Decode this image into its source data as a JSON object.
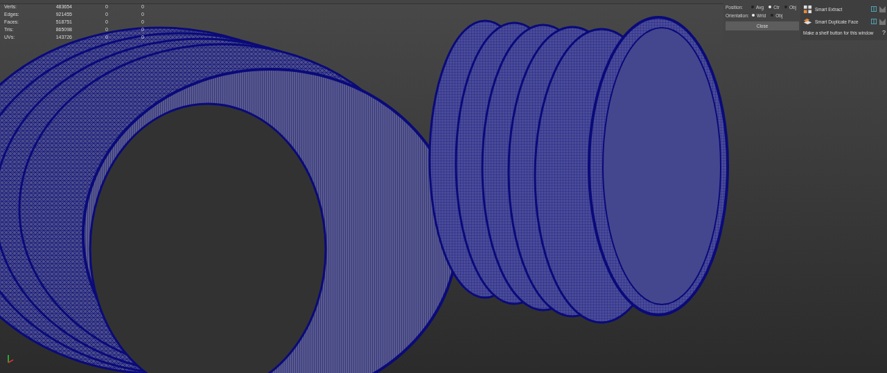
{
  "stats": [
    {
      "label": "Verts:",
      "values": [
        "483654",
        "0",
        "0"
      ]
    },
    {
      "label": "Edges:",
      "values": [
        "921455",
        "0",
        "0"
      ]
    },
    {
      "label": "Faces:",
      "values": [
        "518751",
        "0",
        "0"
      ]
    },
    {
      "label": "Tris:",
      "values": [
        "865098",
        "0",
        "0"
      ]
    },
    {
      "label": "UVs:",
      "values": [
        "143726",
        "0",
        "0"
      ]
    }
  ],
  "options": {
    "rows": [
      {
        "label": "Position:",
        "choices": [
          {
            "label": "Avg",
            "selected": false
          },
          {
            "label": "Ctr",
            "selected": true
          },
          {
            "label": "Obj",
            "selected": false
          }
        ]
      },
      {
        "label": "Orientation:",
        "choices": [
          {
            "label": "Wrld",
            "selected": true
          },
          {
            "label": "Obj",
            "selected": false
          }
        ]
      }
    ],
    "close": "Close"
  },
  "shelf": {
    "items": [
      {
        "label": "Smart Extract",
        "kind": "extract"
      },
      {
        "label": "Smart Duplicate Face",
        "kind": "duplicate"
      }
    ],
    "footer": "Make a shelf button for this window",
    "help": "?"
  }
}
